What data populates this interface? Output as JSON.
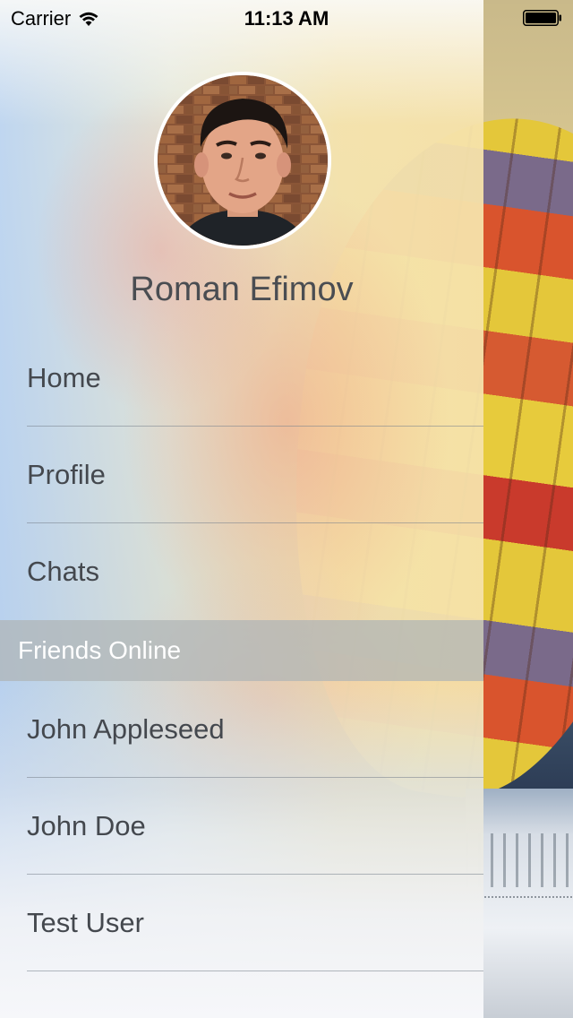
{
  "status_bar": {
    "carrier": "Carrier",
    "time": "11:13 AM"
  },
  "profile": {
    "name": "Roman Efimov"
  },
  "menu": {
    "items": [
      {
        "label": "Home"
      },
      {
        "label": "Profile"
      },
      {
        "label": "Chats"
      }
    ]
  },
  "friends_section": {
    "title": "Friends Online",
    "items": [
      {
        "label": "John Appleseed"
      },
      {
        "label": "John Doe"
      },
      {
        "label": "Test User"
      }
    ]
  },
  "icons": {
    "wifi": "wifi-icon",
    "battery": "battery-icon"
  }
}
